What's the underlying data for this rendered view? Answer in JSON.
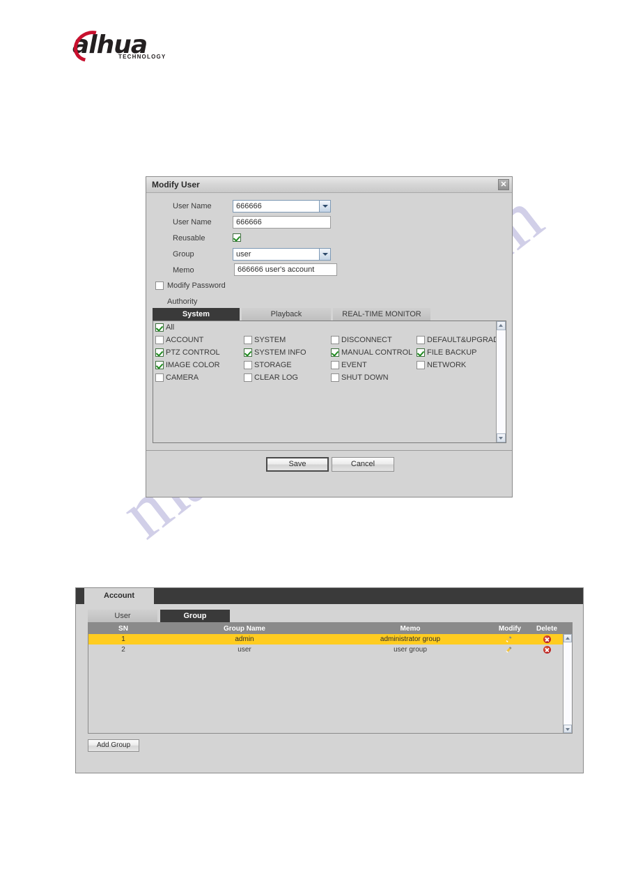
{
  "logo": {
    "word": "alhua",
    "subtitle": "TECHNOLOGY",
    "brand_color": "#c8102e"
  },
  "watermark": {
    "text": "manualshive.com",
    "color": "#b9b6dd"
  },
  "dialog": {
    "title": "Modify User",
    "close_label": "✕",
    "fields": {
      "user_name_select_label": "User Name",
      "user_name_select_value": "666666",
      "user_name_input_label": "User Name",
      "user_name_input_value": "666666",
      "reusable_label": "Reusable",
      "reusable_checked": true,
      "group_label": "Group",
      "group_value": "user",
      "memo_label": "Memo",
      "memo_value": "666666 user's account",
      "modify_password_label": "Modify Password",
      "modify_password_checked": false,
      "authority_label": "Authority"
    },
    "tabs": [
      {
        "label": "System",
        "active": true
      },
      {
        "label": "Playback",
        "active": false
      },
      {
        "label": "REAL-TIME MONITOR",
        "active": false
      }
    ],
    "all_label": "All",
    "all_checked": true,
    "permissions": [
      {
        "label": "ACCOUNT",
        "checked": false
      },
      {
        "label": "SYSTEM",
        "checked": false
      },
      {
        "label": "DISCONNECT",
        "checked": false
      },
      {
        "label": "DEFAULT&UPGRADE",
        "checked": false
      },
      {
        "label": "PTZ CONTROL",
        "checked": true
      },
      {
        "label": "SYSTEM INFO",
        "checked": true
      },
      {
        "label": "MANUAL CONTROL",
        "checked": true
      },
      {
        "label": "FILE BACKUP",
        "checked": true
      },
      {
        "label": "IMAGE COLOR",
        "checked": true
      },
      {
        "label": "STORAGE",
        "checked": false
      },
      {
        "label": "EVENT",
        "checked": false
      },
      {
        "label": "NETWORK",
        "checked": false
      },
      {
        "label": "CAMERA",
        "checked": false
      },
      {
        "label": "CLEAR LOG",
        "checked": false
      },
      {
        "label": "SHUT DOWN",
        "checked": false
      }
    ],
    "buttons": {
      "save_label": "Save",
      "cancel_label": "Cancel"
    }
  },
  "account": {
    "panel_title": "Account",
    "subtabs": [
      {
        "label": "User",
        "active": false
      },
      {
        "label": "Group",
        "active": true
      }
    ],
    "columns": [
      "SN",
      "Group Name",
      "Memo",
      "Modify",
      "Delete"
    ],
    "rows": [
      {
        "sn": "1",
        "group_name": "admin",
        "memo": "administrator group",
        "selected": true
      },
      {
        "sn": "2",
        "group_name": "user",
        "memo": "user group",
        "selected": false
      }
    ],
    "add_group_label": "Add Group",
    "selected_row_color": "#ffcc20"
  }
}
